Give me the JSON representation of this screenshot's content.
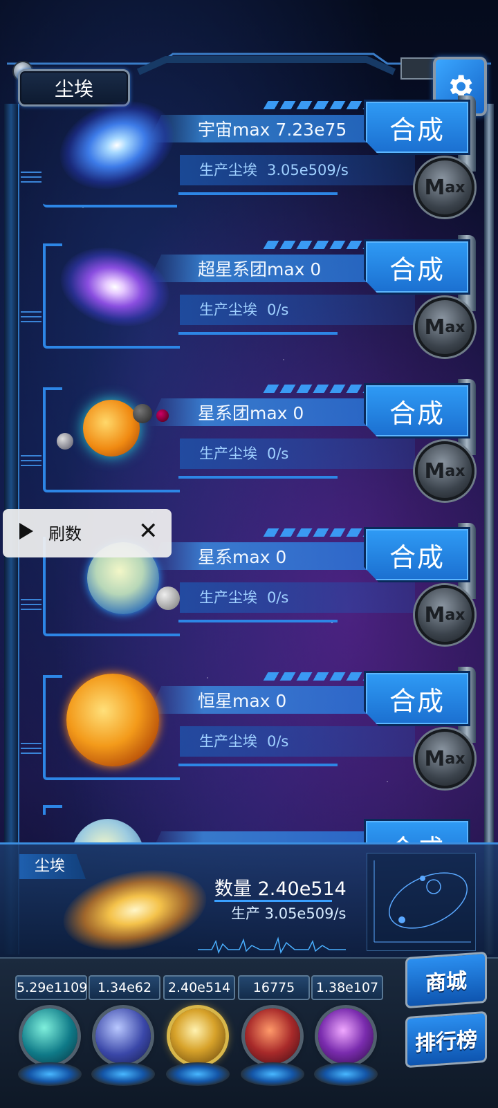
{
  "header": {
    "title": "尘埃"
  },
  "rows": [
    {
      "name": "宇宙max 7.23e75",
      "prod_label": "生产尘埃",
      "prod_value": "3.05e509/s",
      "combine": "合成"
    },
    {
      "name": "超星系团max 0",
      "prod_label": "生产尘埃",
      "prod_value": "0/s",
      "combine": "合成"
    },
    {
      "name": "星系团max 0",
      "prod_label": "生产尘埃",
      "prod_value": "0/s",
      "combine": "合成"
    },
    {
      "name": "星系max 0",
      "prod_label": "生产尘埃",
      "prod_value": "0/s",
      "combine": "合成"
    },
    {
      "name": "恒星max 0",
      "prod_label": "生产尘埃",
      "prod_value": "0/s",
      "combine": "合成"
    },
    {
      "name": "",
      "prod_label": "",
      "prod_value": "",
      "combine": "合成"
    }
  ],
  "max_button": {
    "big": "M",
    "small": "ax"
  },
  "popup": {
    "label": "刷数",
    "close": "✕"
  },
  "panel": {
    "tab": "尘埃",
    "quantity": "数量 2.40e514",
    "production": "生产 3.05e509/s"
  },
  "resources": [
    {
      "value": "5.29e1109",
      "color": "#18a89a"
    },
    {
      "value": "1.34e62",
      "color": "#4a57b8"
    },
    {
      "value": "2.40e514",
      "color": "#c89a26"
    },
    {
      "value": "16775",
      "color": "#b0322e"
    },
    {
      "value": "1.38e107",
      "color": "#7a2cae"
    }
  ],
  "side_buttons": {
    "shop": "商城",
    "rank": "排行榜"
  },
  "colors": {
    "accent": "#2d86e6",
    "button": "#2f9bf5"
  }
}
